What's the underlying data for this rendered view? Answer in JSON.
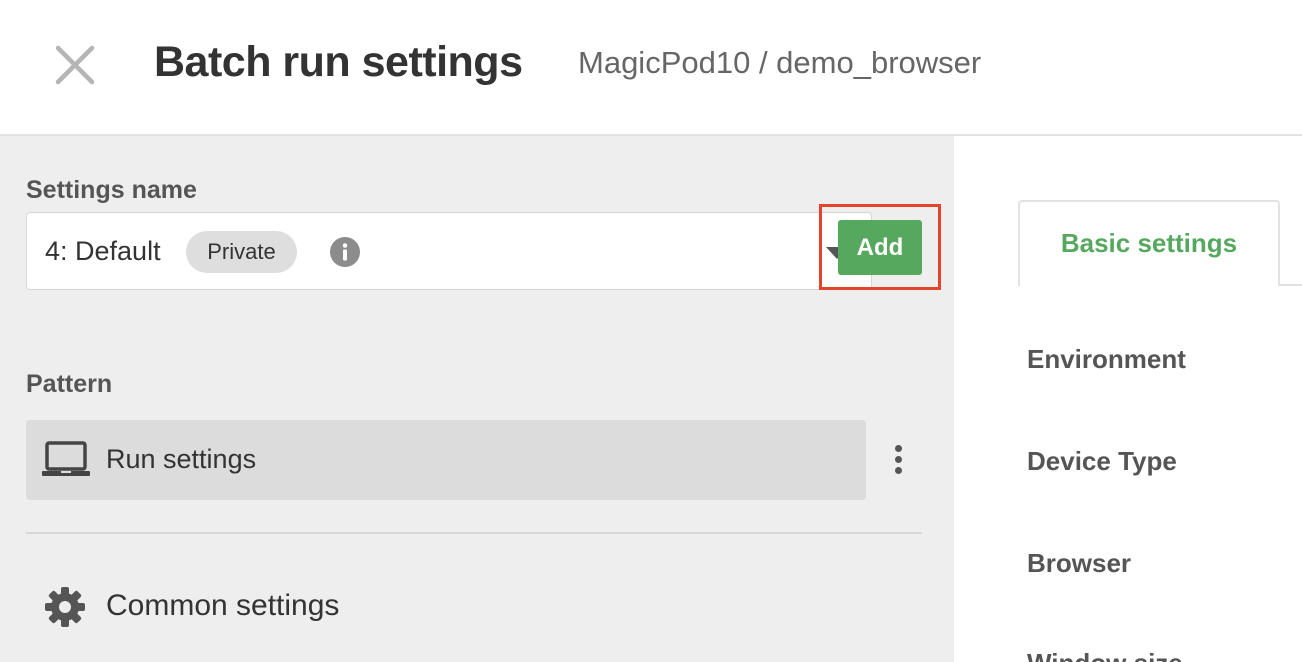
{
  "header": {
    "title": "Batch run settings",
    "breadcrumb": "MagicPod10 / demo_browser",
    "close_icon": "close-icon"
  },
  "left": {
    "settings_name": {
      "label": "Settings name",
      "selected_value": "4: Default",
      "badge": "Private",
      "info_icon": "info-icon",
      "dropdown_icon": "chevron-down-icon",
      "menu_icon": "more-vertical-icon"
    },
    "pattern": {
      "label": "Pattern",
      "add_button": "Add",
      "items": [
        {
          "label": "Run settings",
          "icon": "laptop-icon",
          "menu_icon": "more-vertical-icon"
        }
      ]
    },
    "common_settings": {
      "label": "Common settings",
      "icon": "gear-icon"
    }
  },
  "right": {
    "tabs": [
      {
        "label": "Basic settings",
        "active": true
      }
    ],
    "fields": [
      {
        "label": "Environment"
      },
      {
        "label": "Device Type"
      },
      {
        "label": "Browser"
      },
      {
        "label": "Window size"
      }
    ]
  },
  "colors": {
    "accent_green": "#57a85f",
    "highlight_red": "#e5442c",
    "panel_gray": "#eeeeee",
    "selected_item_gray": "#dcdcdc"
  }
}
